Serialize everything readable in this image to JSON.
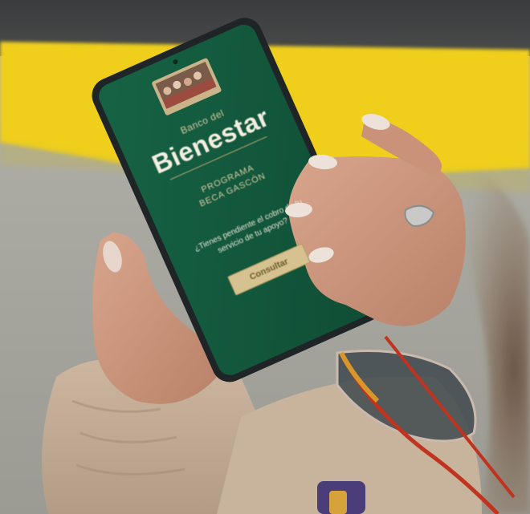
{
  "screen": {
    "brand_small": "Banco del",
    "brand_big": "Bienestar",
    "program_line1": "PROGRAMA",
    "program_line2": "BECA GASCÓN",
    "question": "¿Tienes pendiente el cobro de tu servicio de tu apoyo?",
    "cta_label": "Consultar"
  },
  "colors": {
    "phone_screen": "#14583f",
    "curb_yellow": "#f2d21b",
    "asphalt": "#a4a59e"
  }
}
